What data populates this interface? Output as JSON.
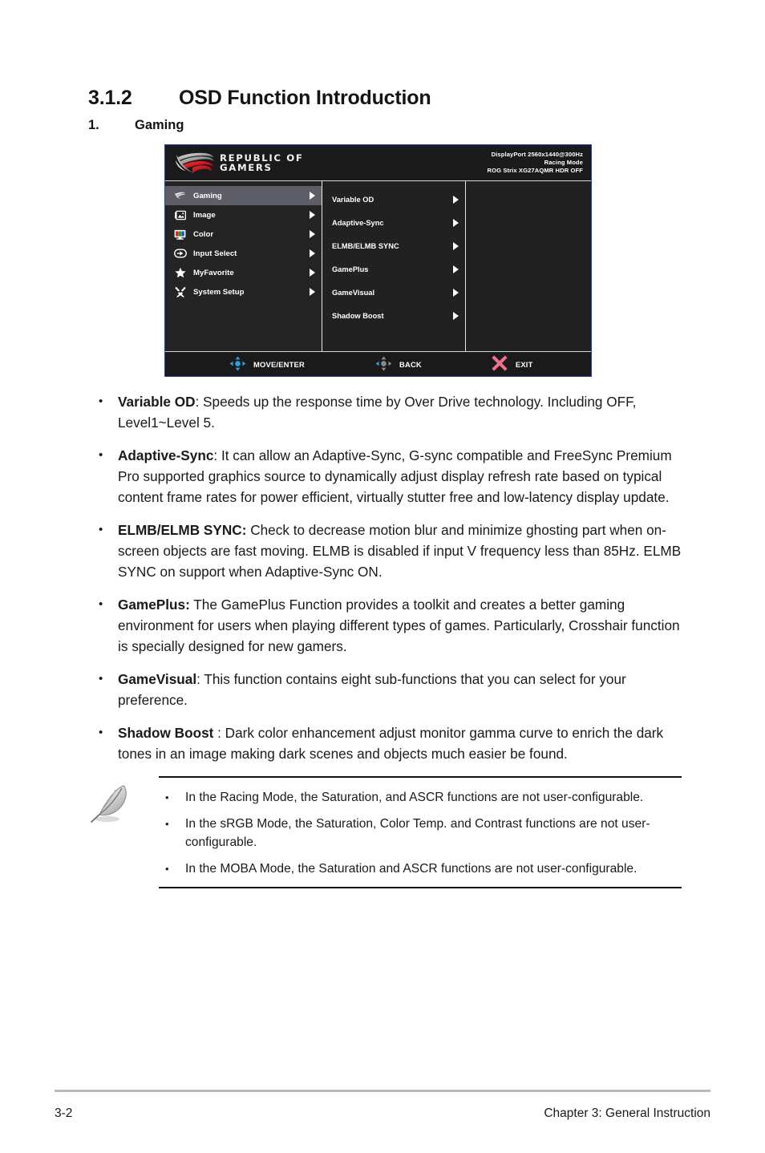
{
  "heading": {
    "number": "3.1.2",
    "title": "OSD Function Introduction",
    "item_number": "1.",
    "item_title": "Gaming"
  },
  "osd": {
    "brand": {
      "line1": "REPUBLIC OF",
      "line2": "GAMERS",
      "logo_icon": "rog-eye-logo"
    },
    "info": {
      "line1": "DisplayPort 2560x1440@300Hz",
      "line2": "Racing Mode",
      "line3": "ROG Strix XG27AQMR HDR OFF"
    },
    "menu": [
      {
        "label": "Gaming",
        "icon": "rog-eye-icon",
        "active": true
      },
      {
        "label": "Image",
        "icon": "picture-icon",
        "active": false
      },
      {
        "label": "Color",
        "icon": "color-monitor-icon",
        "active": false
      },
      {
        "label": "Input Select",
        "icon": "input-arrow-icon",
        "active": false
      },
      {
        "label": "MyFavorite",
        "icon": "star-icon",
        "active": false
      },
      {
        "label": "System Setup",
        "icon": "tools-icon",
        "active": false
      }
    ],
    "submenu": [
      {
        "label": "Variable OD"
      },
      {
        "label": "Adaptive-Sync"
      },
      {
        "label": "ELMB/ELMB SYNC"
      },
      {
        "label": "GamePlus"
      },
      {
        "label": "GameVisual"
      },
      {
        "label": "Shadow Boost"
      }
    ],
    "footer": {
      "move_label": "MOVE/ENTER",
      "back_label": "BACK",
      "exit_label": "EXIT",
      "move_icon": "dpad-blue-icon",
      "back_icon": "dpad-gray-icon",
      "exit_icon": "x-close-icon"
    },
    "colors": {
      "border": "#2b3fa0",
      "panel_bg": "#1e1e1e",
      "highlight": "#5e5e68",
      "accent_blue": "#2f9de0",
      "accent_pink": "#f0718f"
    }
  },
  "bullets": [
    {
      "bullet": "•",
      "term": "Variable OD",
      "rest": ": Speeds up the response time by Over Drive technology. Including OFF, Level1~Level 5."
    },
    {
      "bullet": "•",
      "term": "Adaptive-Sync",
      "rest": ": It can allow an Adaptive-Sync, G-sync compatible and FreeSync Premium Pro supported graphics source to dynamically adjust display refresh rate based on typical content frame rates for power efficient, virtually stutter free and low-latency display update."
    },
    {
      "bullet": "•",
      "term": "ELMB/ELMB SYNC:",
      "rest": " Check to decrease motion blur and minimize ghosting part when on-screen objects are fast moving. ELMB is disabled if input V frequency less than 85Hz. ELMB SYNC on support when Adaptive-Sync ON."
    },
    {
      "bullet": "•",
      "term": "GamePlus:",
      "rest": " The GamePlus Function provides a toolkit and creates a better gaming environment for users when playing different types of games. Particularly, Crosshair function is specially designed for new gamers."
    },
    {
      "bullet": "•",
      "term": "GameVisual",
      "rest": ": This function contains eight sub-functions that you can select for your preference."
    },
    {
      "bullet": "•",
      "term": "Shadow Boost",
      "rest": " : Dark color enhancement adjust monitor gamma curve to enrich the dark tones in an image making dark scenes and objects much easier be found."
    }
  ],
  "note": {
    "icon": "pencil-note-icon",
    "items": [
      {
        "bullet": "•",
        "text": "In the Racing Mode, the Saturation, and ASCR functions are not user-configurable."
      },
      {
        "bullet": "•",
        "text": "In the sRGB Mode, the Saturation, Color Temp. and Contrast functions are not user-configurable."
      },
      {
        "bullet": "•",
        "text": "In the MOBA Mode, the Saturation and ASCR functions are not user-configurable."
      }
    ]
  },
  "page_footer": {
    "page_number": "3-2",
    "chapter": "Chapter 3: General Instruction"
  }
}
